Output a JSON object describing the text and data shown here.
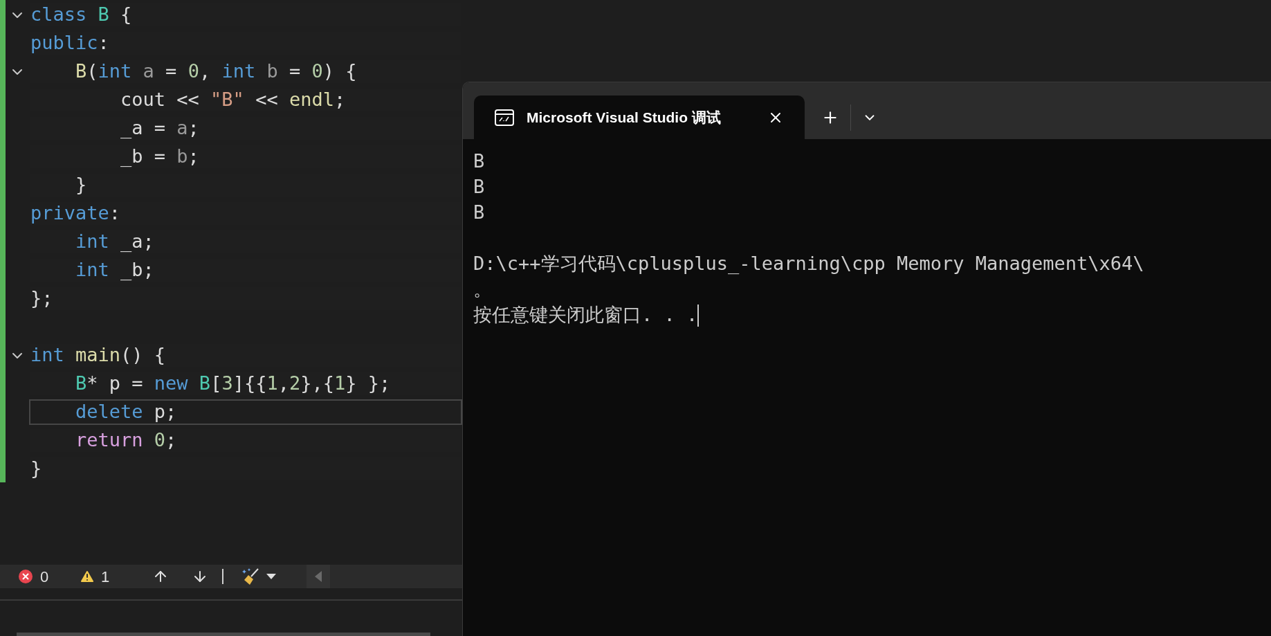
{
  "editor": {
    "lines": [
      {
        "kind": "code",
        "expanded": true,
        "selected": false,
        "tokens": [
          {
            "kind": "keyword",
            "text": "class"
          },
          {
            "kind": "type",
            "text": " B"
          },
          {
            "kind": "plain",
            "text": " {"
          }
        ]
      },
      {
        "kind": "code",
        "selected": false,
        "tokens": [
          {
            "kind": "keyword",
            "text": "public"
          },
          {
            "kind": "plain",
            "text": ":"
          }
        ]
      },
      {
        "kind": "code",
        "expanded": true,
        "selected": false,
        "tokens": [
          {
            "kind": "func",
            "text": "    B"
          },
          {
            "kind": "plain",
            "text": "("
          },
          {
            "kind": "keyword",
            "text": "int"
          },
          {
            "kind": "param",
            "text": " a"
          },
          {
            "kind": "plain",
            "text": " = "
          },
          {
            "kind": "number",
            "text": "0"
          },
          {
            "kind": "plain",
            "text": ", "
          },
          {
            "kind": "keyword",
            "text": "int"
          },
          {
            "kind": "param",
            "text": " b"
          },
          {
            "kind": "plain",
            "text": " = "
          },
          {
            "kind": "number",
            "text": "0"
          },
          {
            "kind": "plain",
            "text": ") {"
          }
        ]
      },
      {
        "kind": "code",
        "selected": false,
        "tokens": [
          {
            "kind": "plain",
            "text": "        cout << "
          },
          {
            "kind": "string",
            "text": "\"B\""
          },
          {
            "kind": "plain",
            "text": " << "
          },
          {
            "kind": "func",
            "text": "endl"
          },
          {
            "kind": "plain",
            "text": ";"
          }
        ]
      },
      {
        "kind": "code",
        "selected": false,
        "tokens": [
          {
            "kind": "plain",
            "text": "        _a = "
          },
          {
            "kind": "param",
            "text": "a"
          },
          {
            "kind": "plain",
            "text": ";"
          }
        ]
      },
      {
        "kind": "code",
        "selected": false,
        "tokens": [
          {
            "kind": "plain",
            "text": "        _b = "
          },
          {
            "kind": "param",
            "text": "b"
          },
          {
            "kind": "plain",
            "text": ";"
          }
        ]
      },
      {
        "kind": "code",
        "selected": false,
        "tokens": [
          {
            "kind": "plain",
            "text": "    }"
          }
        ]
      },
      {
        "kind": "code",
        "selected": false,
        "tokens": [
          {
            "kind": "keyword",
            "text": "private"
          },
          {
            "kind": "plain",
            "text": ":"
          }
        ]
      },
      {
        "kind": "code",
        "selected": false,
        "tokens": [
          {
            "kind": "keyword",
            "text": "    int"
          },
          {
            "kind": "plain",
            "text": " _a;"
          }
        ]
      },
      {
        "kind": "code",
        "selected": false,
        "tokens": [
          {
            "kind": "keyword",
            "text": "    int"
          },
          {
            "kind": "plain",
            "text": " _b;"
          }
        ]
      },
      {
        "kind": "code",
        "selected": false,
        "tokens": [
          {
            "kind": "plain",
            "text": "};"
          }
        ]
      },
      {
        "kind": "blank"
      },
      {
        "kind": "code",
        "expanded": true,
        "selected": false,
        "tokens": [
          {
            "kind": "keyword",
            "text": "int"
          },
          {
            "kind": "func",
            "text": " main"
          },
          {
            "kind": "plain",
            "text": "() {"
          }
        ]
      },
      {
        "kind": "code",
        "selected": false,
        "tokens": [
          {
            "kind": "type",
            "text": "    B"
          },
          {
            "kind": "plain",
            "text": "* p = "
          },
          {
            "kind": "keyword",
            "text": "new"
          },
          {
            "kind": "type",
            "text": " B"
          },
          {
            "kind": "plain",
            "text": "["
          },
          {
            "kind": "number",
            "text": "3"
          },
          {
            "kind": "plain",
            "text": "]{{"
          },
          {
            "kind": "number",
            "text": "1"
          },
          {
            "kind": "plain",
            "text": ","
          },
          {
            "kind": "number",
            "text": "2"
          },
          {
            "kind": "plain",
            "text": "},{"
          },
          {
            "kind": "number",
            "text": "1"
          },
          {
            "kind": "plain",
            "text": "} };"
          }
        ]
      },
      {
        "kind": "code",
        "selected": true,
        "tokens": [
          {
            "kind": "keyword",
            "text": "    delete"
          },
          {
            "kind": "plain",
            "text": " p;"
          }
        ]
      },
      {
        "kind": "code",
        "selected": false,
        "tokens": [
          {
            "kind": "control",
            "text": "    return"
          },
          {
            "kind": "number",
            "text": " 0"
          },
          {
            "kind": "plain",
            "text": ";"
          }
        ]
      },
      {
        "kind": "code",
        "selected": false,
        "tokens": [
          {
            "kind": "plain",
            "text": "}"
          }
        ]
      }
    ]
  },
  "status_bar": {
    "errors": "0",
    "warnings": "1"
  },
  "terminal": {
    "tab": {
      "title": "Microsoft Visual Studio 调试",
      "selected": true
    },
    "output": [
      {
        "kind": "text",
        "text": "B"
      },
      {
        "kind": "text",
        "text": "B"
      },
      {
        "kind": "text",
        "text": "B"
      },
      {
        "kind": "blank"
      },
      {
        "kind": "text",
        "text": "D:\\c++学习代码\\cplusplus_-learning\\cpp Memory Management\\x64\\"
      },
      {
        "kind": "text",
        "text": "。"
      },
      {
        "kind": "text",
        "text": "按任意键关闭此窗口. . ."
      }
    ]
  }
}
